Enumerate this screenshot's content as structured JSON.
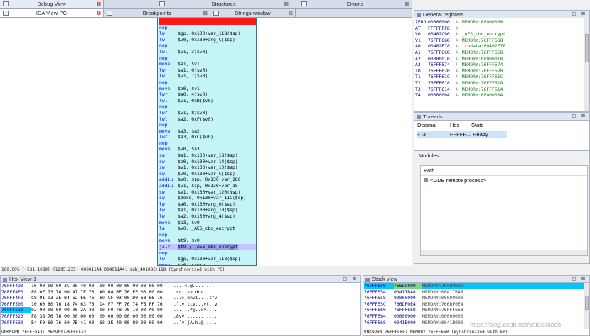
{
  "tabs_row1": {
    "debug_view": "Debug View",
    "structures": "Structures",
    "enums": "Enums"
  },
  "tabs_row2": {
    "ida_view": "IDA View-PC",
    "breakpoints": "Breakpoints",
    "strings": "Strings window"
  },
  "disasm": [
    {
      "m": "",
      "o": "",
      "c": "",
      "hl": "red"
    },
    {
      "m": "nop",
      "o": "",
      "c": ""
    },
    {
      "m": "lw",
      "o": "$gp, 0x130+var_118($sp)",
      "c": ""
    },
    {
      "m": "lw",
      "o": "$v0, 0x130+arg_C($sp)",
      "c": ""
    },
    {
      "m": "nop",
      "o": "",
      "c": ""
    },
    {
      "m": "lwl",
      "o": "$v1, 3($v0)",
      "c": ""
    },
    {
      "m": "nop",
      "o": "",
      "c": ""
    },
    {
      "m": "move",
      "o": "$a1, $v1",
      "c": ""
    },
    {
      "m": "lwr",
      "o": "$a1, 0($v0)",
      "c": ""
    },
    {
      "m": "lwl",
      "o": "$v1, 7($v0)",
      "c": ""
    },
    {
      "m": "nop",
      "o": "",
      "c": ""
    },
    {
      "m": "move",
      "o": "$a0, $v1",
      "c": ""
    },
    {
      "m": "lwr",
      "o": "$a0, 4($v0)",
      "c": ""
    },
    {
      "m": "lwl",
      "o": "$v1, 0xB($v0)",
      "c": ""
    },
    {
      "m": "nop",
      "o": "",
      "c": ""
    },
    {
      "m": "lwr",
      "o": "$v1, 8($v0)",
      "c": ""
    },
    {
      "m": "lwl",
      "o": "$a2, 0xF($v0)",
      "c": ""
    },
    {
      "m": "nop",
      "o": "",
      "c": ""
    },
    {
      "m": "move",
      "o": "$a3, $a2",
      "c": ""
    },
    {
      "m": "lwr",
      "o": "$a3, 0xC($v0)",
      "c": ""
    },
    {
      "m": "nop",
      "o": "",
      "c": ""
    },
    {
      "m": "move",
      "o": "$v0, $a3",
      "c": ""
    },
    {
      "m": "sw",
      "o": "$a1, 0x130+var_18($sp)",
      "c": ""
    },
    {
      "m": "sw",
      "o": "$a0, 0x130+var_14($sp)",
      "c": ""
    },
    {
      "m": "sw",
      "o": "$v1, 0x130+var_10($sp)",
      "c": ""
    },
    {
      "m": "sw",
      "o": "$v0, 0x130+var_C($sp)",
      "c": ""
    },
    {
      "m": "addiu",
      "o": "$v0, $sp, 0x130+var_18C",
      "c": ""
    },
    {
      "m": "addiu",
      "o": "$v1, $sp, 0x130+var_18",
      "c": ""
    },
    {
      "m": "sw",
      "o": "$v1, 0x130+var_120($sp)",
      "c": ""
    },
    {
      "m": "sw",
      "o": "$zero, 0x130+var_11C($sp)",
      "c": ""
    },
    {
      "m": "lw",
      "o": "$a0, 0x130+arg_0($sp)",
      "c": ""
    },
    {
      "m": "lw",
      "o": "$a1, 0x130+arg_10($sp)",
      "c": ""
    },
    {
      "m": "lw",
      "o": "$a2, 0x130+arg_4($sp)",
      "c": ""
    },
    {
      "m": "move",
      "o": "$a3, $v0",
      "c": ""
    },
    {
      "m": "la",
      "o": "$v0, _AES_cbc_encrypt",
      "c": ""
    },
    {
      "m": "nop",
      "o": "",
      "c": ""
    },
    {
      "m": "move",
      "o": "$t9, $v0",
      "c": ""
    },
    {
      "m": "jalr",
      "o": "$t9 ; _AES_cbc_encrypt",
      "c": "",
      "hl": "blue"
    },
    {
      "m": "nop",
      "o": "",
      "c": ""
    },
    {
      "m": "lw",
      "o": "$gp, 0x130+var_118($sp)",
      "c": ""
    },
    {
      "m": "move",
      "o": "$v0, $zero",
      "c": ""
    },
    {
      "m": "lw",
      "o": "$ra, 0x130+var_4($sp)",
      "c": ""
    }
  ],
  "disasm_status": "100.00% (-531,1089) (1295,235) 000011A4 004011A4: sub_40108C+118 (Synchronized with PC)",
  "registers": {
    "title": "General registers",
    "rows": [
      {
        "n": "ZERO",
        "v": "00000000",
        "d": "MEMORY:00000000"
      },
      {
        "n": "AT",
        "v": "FFFFFFF8",
        "d": ""
      },
      {
        "n": "V0",
        "v": "00402C90",
        "d": "_AES_cbc_encrypt"
      },
      {
        "n": "V1",
        "v": "76FFF668",
        "d": "MEMORY:76FFF668"
      },
      {
        "n": "A0",
        "v": "00402E78",
        "d": ".rodata:00402E78"
      },
      {
        "n": "A1",
        "v": "76FFF6C8",
        "d": "MEMORY:76FFF6C8"
      },
      {
        "n": "A2",
        "v": "00000010",
        "d": "MEMORY:00000010"
      },
      {
        "n": "A3",
        "v": "76FFF574",
        "d": "MEMORY:76FFF574"
      },
      {
        "n": "T0",
        "v": "76FFF620",
        "d": "MEMORY:76FFF620"
      },
      {
        "n": "T1",
        "v": "76FFF61C",
        "d": "MEMORY:76FFF61C"
      },
      {
        "n": "T2",
        "v": "76FFF618",
        "d": "MEMORY:76FFF618"
      },
      {
        "n": "T3",
        "v": "76FFF614",
        "d": "MEMORY:76FFF614"
      },
      {
        "n": "T4",
        "v": "0000000A",
        "d": "MEMORY:0000000A"
      }
    ]
  },
  "threads": {
    "title": "Threads",
    "cols": [
      "Decimal",
      "Hex",
      "State"
    ],
    "row": {
      "dec": "-3",
      "hex": "FFFFF...",
      "state": "Ready"
    }
  },
  "modules": {
    "title": "Modules",
    "col": "Path",
    "item": "<GDB remote process>"
  },
  "hex": {
    "title": "Hex View-1",
    "rows": [
      {
        "a": "76FFF4D0",
        "b": "10 00 00 00 3C 08 40 00  00 00 00 00 00 00 00 00",
        "t": "....<.@........"
      },
      {
        "a": "76FFF4E0",
        "b": "F8 OF 73 76 00 A7 7E 76  A0 64 6E 76 FE 00 00 00",
        "t": ".sv..~v.dnv...."
      },
      {
        "a": "76FFF4F0",
        "b": "C8 91 93 3E B4 62 6E 76  69 CF 03 00 D0 63 66 76",
        "t": "...>.bnvi....cfv"
      },
      {
        "a": "76FFF500",
        "b": "10 60 80 76 18 74 63 76  D4 F7 FF 76 74 F5 FF 76",
        "t": ".`.v.tcv...vt..v"
      },
      {
        "a": "76FFF510",
        "b": "02 00 00 00 00 00 2A 40  00 F0 78 76 18 00 A0 00",
        "t": "......*@..xv...."
      },
      {
        "a": "76FFF520",
        "b": "F8 38 76 76 00 00 00 00  00 00 00 00 00 00 00 00",
        "t": ".8vv............"
      },
      {
        "a": "76FFF530",
        "b": "E4 F0 60 76 60 7B 41 00  68 2E 40 00 80 00 00 00",
        "t": "..`v`{A.h.@....."
      }
    ],
    "status": "UNKNOWN 76FFF514: MEMORY:76FFF514"
  },
  "stack": {
    "title": "Stack view",
    "rows": [
      {
        "a": "76FFF550",
        "v": "766D9000",
        "d": "MEMORY:766D9000"
      },
      {
        "a": "76FFF554",
        "v": "00417BA8",
        "d": "MEMORY:00417BA8"
      },
      {
        "a": "76FFF558",
        "v": "00000000",
        "d": "MEMORY:00000000"
      },
      {
        "a": "76FFF55C",
        "v": "766DF0E4",
        "d": "MEMORY:766DF0E4"
      },
      {
        "a": "76FFF560",
        "v": "76FFF668",
        "d": "MEMORY:76FFF668"
      },
      {
        "a": "76FFF564",
        "v": "00000000",
        "d": "MEMORY:00000000"
      },
      {
        "a": "76FFF568",
        "v": "0041B000",
        "d": "MEMORY:0041B000"
      }
    ],
    "status": "UNKNOWN 76FFF550: MEMORY:76FFF550 (Synchronized with SP)",
    "watermark": "https://blog.csdn.net/yalecaltech"
  }
}
